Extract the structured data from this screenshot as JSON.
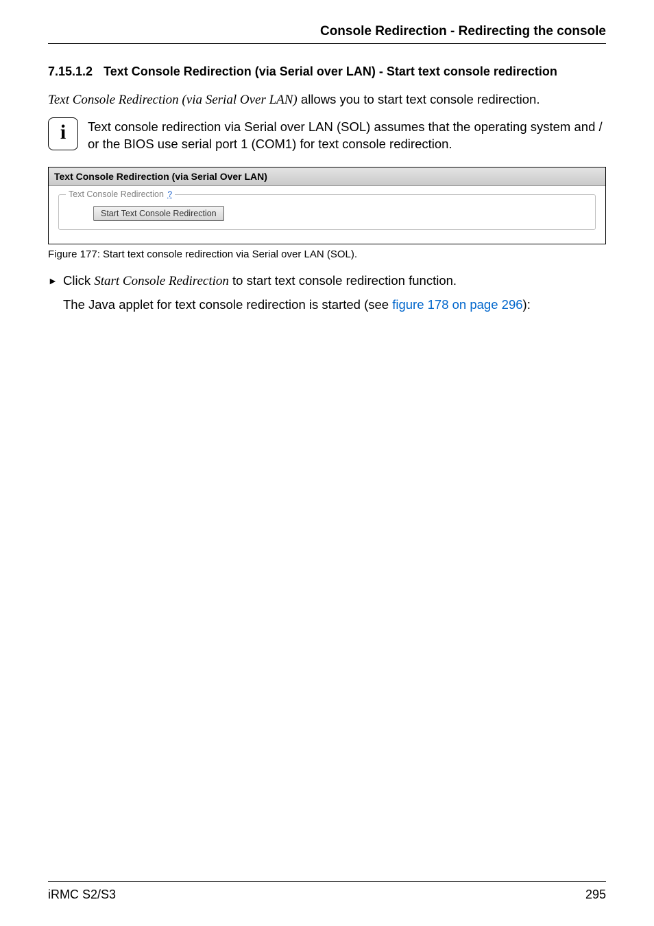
{
  "header": {
    "running_title": "Console Redirection - Redirecting the console"
  },
  "section": {
    "number": "7.15.1.2",
    "title": "Text Console Redirection (via Serial over LAN) - Start text console redirection"
  },
  "intro": {
    "italic_lead": "Text Console Redirection (via Serial Over LAN)",
    "rest": " allows you to start text console redirection."
  },
  "info_note": {
    "text": "Text console redirection via Serial over LAN (SOL) assumes that the operating system and / or the BIOS use serial port 1 (COM1) for text console redirection.",
    "icon_name": "info-icon"
  },
  "screenshot": {
    "titlebar": "Text Console Redirection (via Serial Over LAN)",
    "legend_text": "Text Console Redirection",
    "legend_mark": "?",
    "button_label": "Start Text Console Redirection"
  },
  "figure": {
    "caption": "Figure 177: Start text console redirection via Serial over LAN (SOL)."
  },
  "bullet": {
    "action_prefix": "Click ",
    "action_italic": "Start Console Redirection",
    "action_suffix": " to start text console redirection function."
  },
  "followup": {
    "pre_link": "The Java applet for text console redirection is started (see ",
    "link_text": "figure 178 on page 296",
    "post_link": "):"
  },
  "footer": {
    "left": "iRMC S2/S3",
    "right": "295"
  }
}
